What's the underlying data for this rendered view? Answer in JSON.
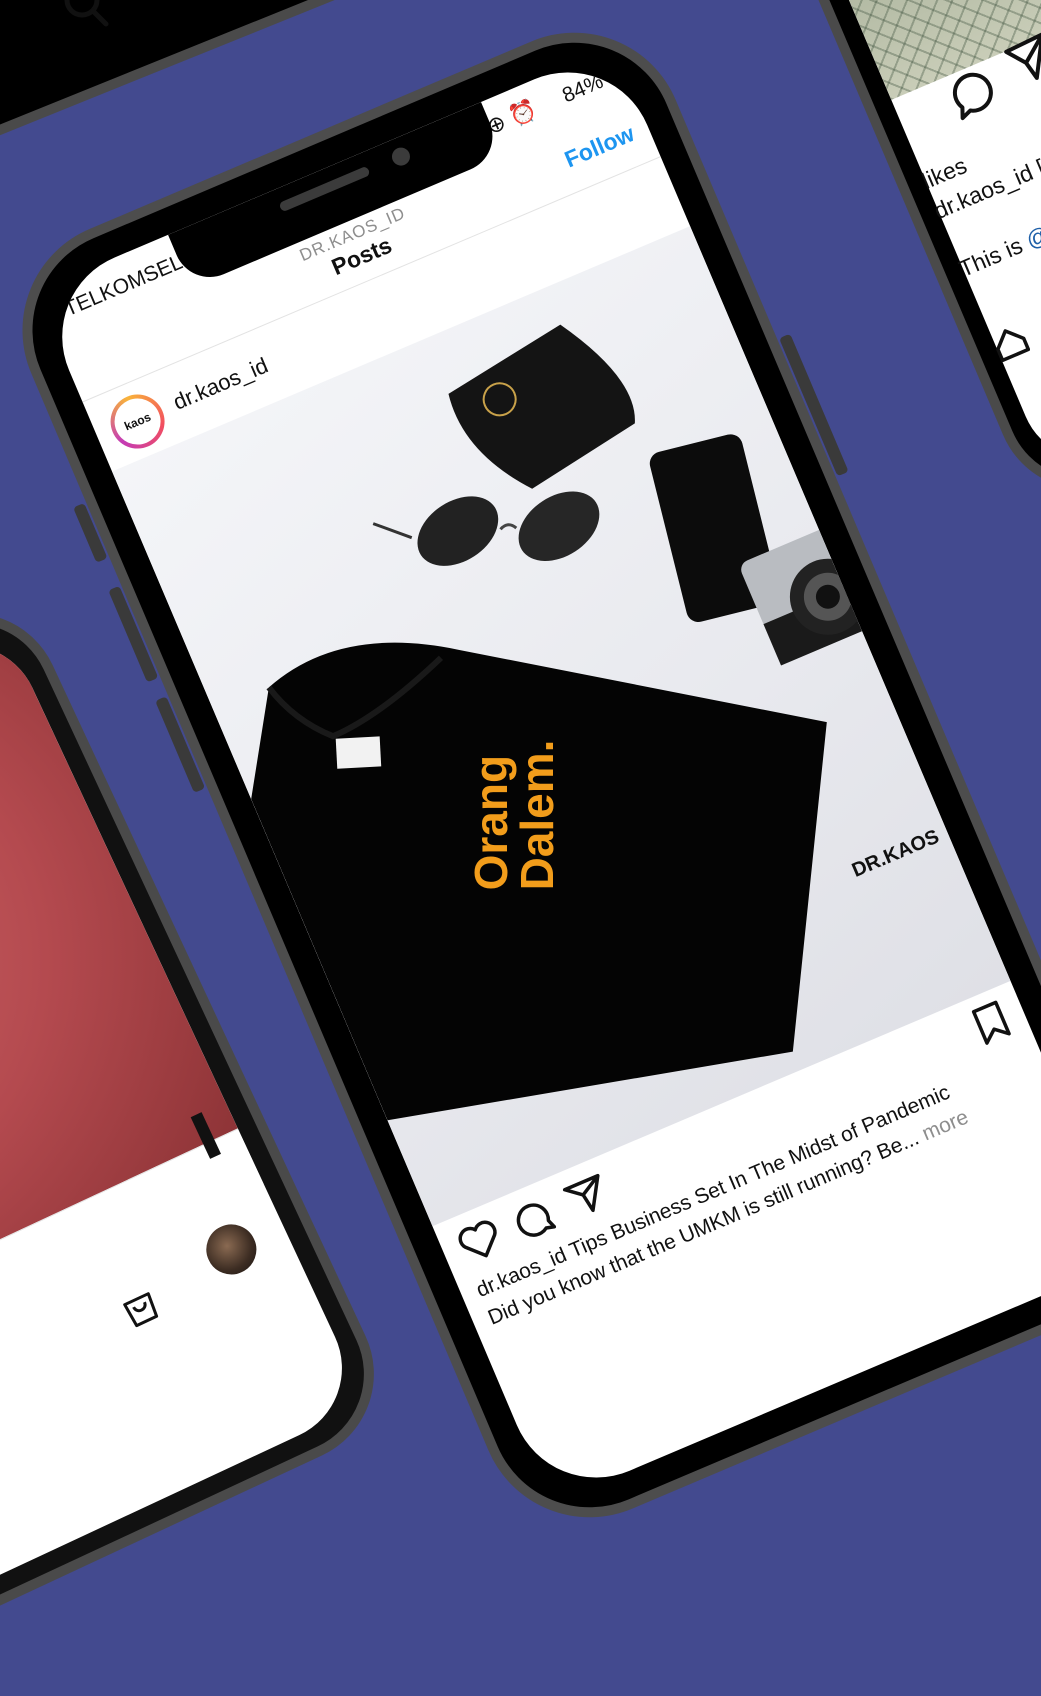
{
  "main_phone": {
    "status_bar": {
      "carrier": "TELKOMSEL",
      "battery": "84%"
    },
    "header": {
      "account_label": "DR.KAOS_ID",
      "title": "Posts",
      "follow_label": "Follow"
    },
    "post": {
      "username": "dr.kaos_id",
      "avatar_text": "kaos",
      "shirt_text_line1": "Orang",
      "shirt_text_line2": "Dalem.",
      "watermark": "DR.KAOS",
      "caption_line1": "dr.kaos_id Tips Business Set In The Midst of Pandemic",
      "caption_line2": "Did you know that the UMKM is still running? Be...",
      "caption_more": "more"
    }
  },
  "right_phone": {
    "likes_text": "likes",
    "caption_text": "dr.kaos_id [St",
    "mention_prefix": "This is",
    "mention": "@na"
  },
  "colors": {
    "background": "#434a8f",
    "follow_blue": "#1d95f0",
    "shirt_text_orange": "#f29d1b",
    "left_photo_red": "#b44a4f"
  }
}
